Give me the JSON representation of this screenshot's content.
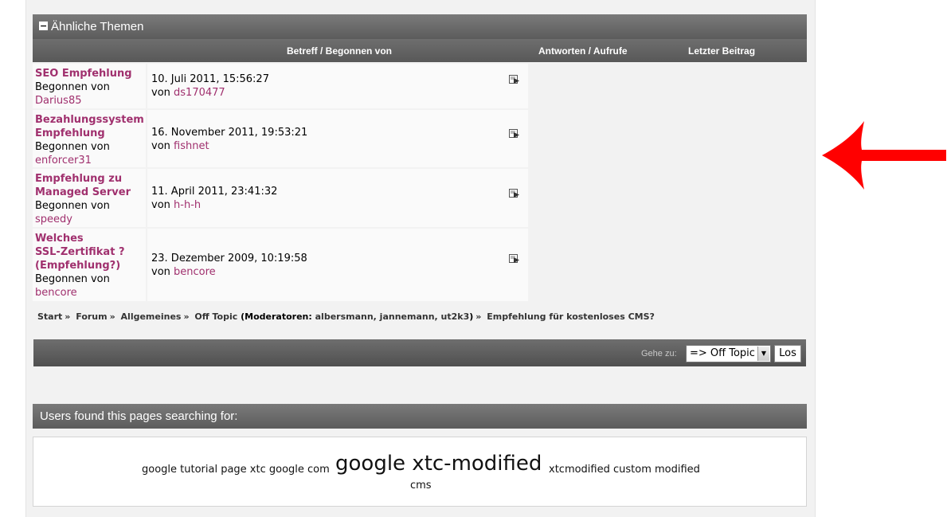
{
  "similar_topics": {
    "title": "Ähnliche Themen",
    "columns": {
      "subject": "Betreff / Begonnen von",
      "replies": "Antworten / Aufrufe",
      "last_post": "Letzter Beitrag"
    },
    "started_by_label": "Begonnen von",
    "by_label": "von",
    "topics": [
      {
        "title": "SEO Empfehlung",
        "starter": "Darius85",
        "date": "10. Juli 2011, 15:56:27",
        "last_user": "ds170477"
      },
      {
        "title_lines": [
          "Bezahlungssystem",
          "Empfehlung"
        ],
        "starter": "enforcer31",
        "date": "16. November 2011, 19:53:21",
        "last_user": "fishnet"
      },
      {
        "title_lines": [
          "Empfehlung zu",
          "Managed Server"
        ],
        "starter": "speedy",
        "date": "11. April 2011, 23:41:32",
        "last_user": "h-h-h"
      },
      {
        "title_lines": [
          "Welches",
          "SSL-Zertifikat ?",
          "(Empfehlung?)"
        ],
        "starter": "bencore",
        "date": "23. Dezember 2009, 10:19:58",
        "last_user": "bencore"
      }
    ],
    "last_post_icon": "last-post-icon"
  },
  "breadcrumb": {
    "start": "Start",
    "forum": "Forum",
    "general": "Allgemeines",
    "offtopic": "Off Topic",
    "moderators_open": "(",
    "moderators_label": "Moderatoren:",
    "moderators": "albersmann, jannemann, ut2k3",
    "moderators_close": ")",
    "current": "Empfehlung für kostenloses CMS?",
    "separator": "»"
  },
  "jump": {
    "label": "Gehe zu:",
    "selected": "=> Off Topic",
    "go_button": "Los"
  },
  "search_terms": {
    "title": "Users found this pages searching for:",
    "tags": {
      "t1": "google tutorial page xtc google com",
      "t2": "google xtc-modified",
      "t3": "xtcmodified custom modified",
      "t4": "cms"
    }
  },
  "colors": {
    "link": "#a0306e",
    "header_bar": "#666666",
    "annotation_arrow": "#ff0000"
  }
}
